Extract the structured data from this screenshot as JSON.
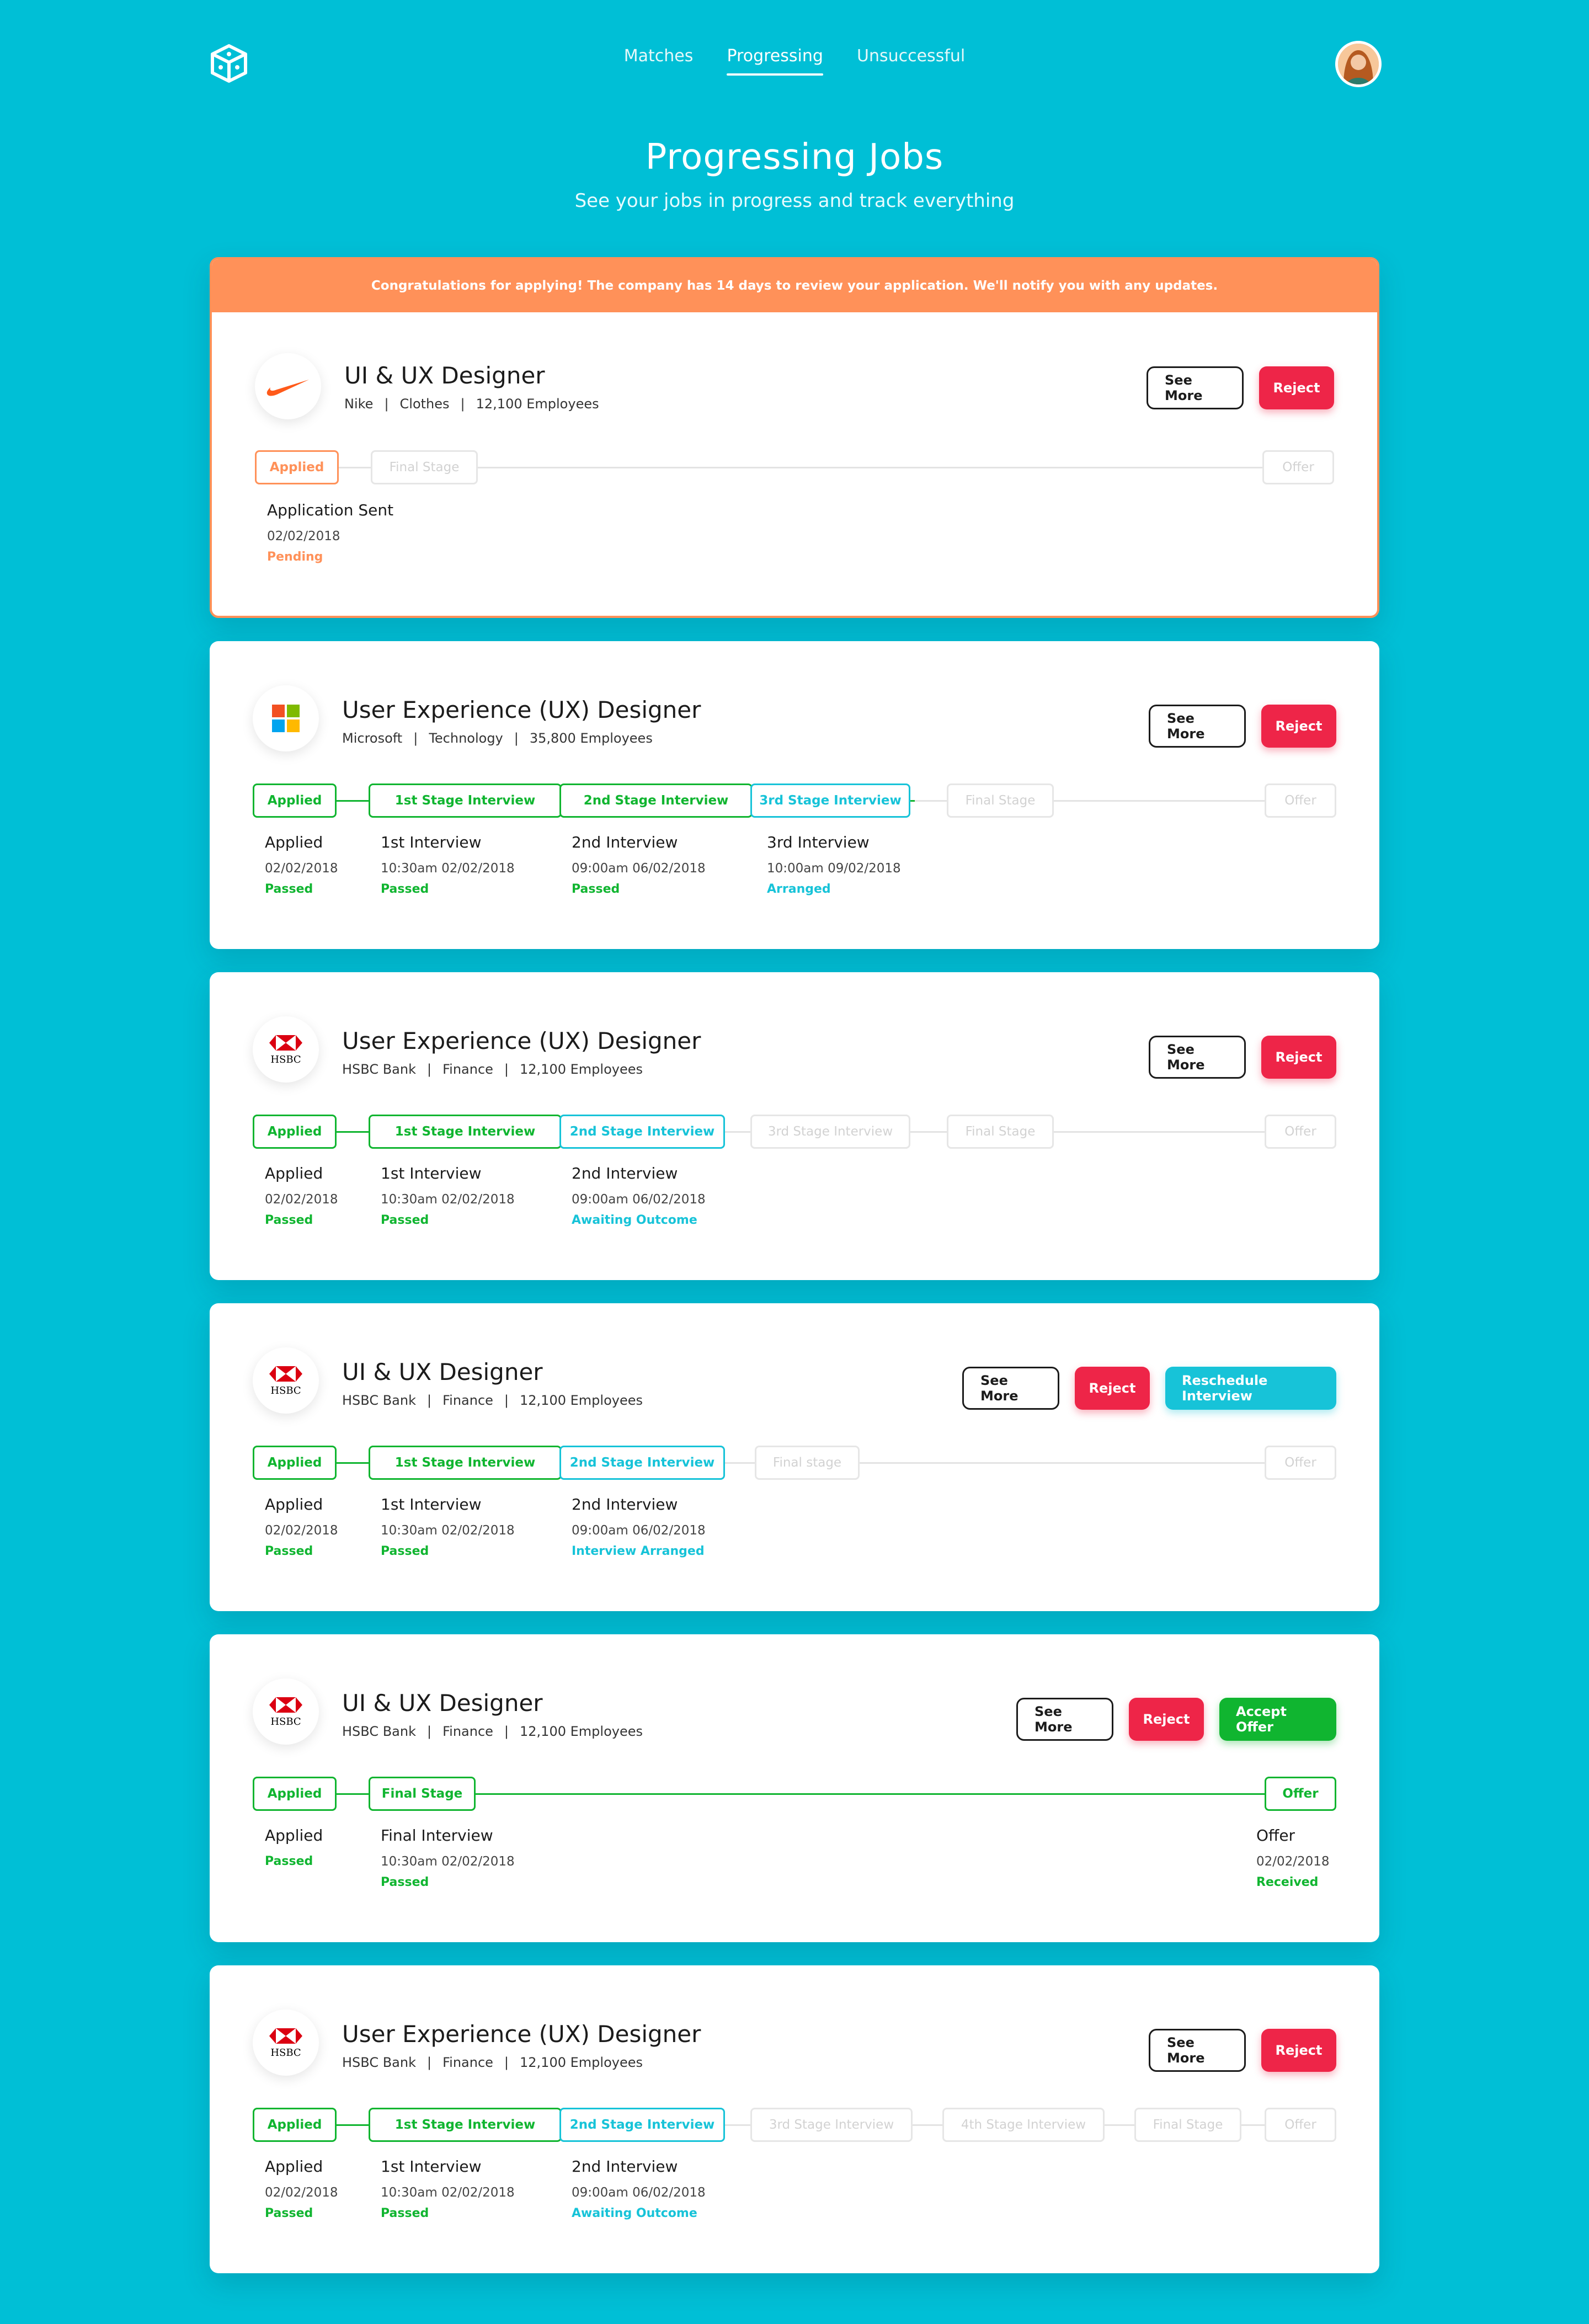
{
  "nav": {
    "tabs": [
      "Matches",
      "Progressing",
      "Unsuccessful"
    ],
    "active": "Progressing"
  },
  "header": {
    "title": "Progressing Jobs",
    "subtitle": "See your jobs in progress and track everything"
  },
  "banner": "Congratulations for applying! The company has 14 days to review your application. We'll notify you with any updates.",
  "buttons": {
    "see_more": "See More",
    "reject": "Reject",
    "reschedule": "Reschedule Interview",
    "accept": "Accept Offer"
  },
  "cards": [
    {
      "title": "UI & UX Designer",
      "company": "Nike",
      "sector": "Clothes",
      "employees": "12,100 Employees",
      "stages": [
        "Applied",
        "Final Stage",
        "Offer"
      ],
      "details": [
        {
          "title": "Application Sent",
          "date": "02/02/2018",
          "status": "Pending"
        }
      ]
    },
    {
      "title": "User Experience (UX) Designer",
      "company": "Microsoft",
      "sector": "Technology",
      "employees": "35,800 Employees",
      "stages": [
        "Applied",
        "1st Stage Interview",
        "2nd Stage Interview",
        "3rd Stage Interview",
        "Final Stage",
        "Offer"
      ],
      "details": [
        {
          "title": "Applied",
          "date": "02/02/2018",
          "status": "Passed"
        },
        {
          "title": "1st Interview",
          "date": "10:30am 02/02/2018",
          "status": "Passed"
        },
        {
          "title": "2nd Interview",
          "date": "09:00am 06/02/2018",
          "status": "Passed"
        },
        {
          "title": "3rd Interview",
          "date": "10:00am 09/02/2018",
          "status": "Arranged"
        }
      ]
    },
    {
      "title": "User Experience (UX) Designer",
      "company": "HSBC Bank",
      "sector": "Finance",
      "employees": "12,100 Employees",
      "stages": [
        "Applied",
        "1st Stage Interview",
        "2nd Stage Interview",
        "3rd Stage Interview",
        "Final Stage",
        "Offer"
      ],
      "details": [
        {
          "title": "Applied",
          "date": "02/02/2018",
          "status": "Passed"
        },
        {
          "title": "1st Interview",
          "date": "10:30am 02/02/2018",
          "status": "Passed"
        },
        {
          "title": "2nd Interview",
          "date": "09:00am 06/02/2018",
          "status": "Awaiting Outcome"
        }
      ]
    },
    {
      "title": "UI & UX Designer",
      "company": "HSBC Bank",
      "sector": "Finance",
      "employees": "12,100 Employees",
      "stages": [
        "Applied",
        "1st Stage Interview",
        "2nd Stage Interview",
        "Final stage",
        "Offer"
      ],
      "details": [
        {
          "title": "Applied",
          "date": "02/02/2018",
          "status": "Passed"
        },
        {
          "title": "1st Interview",
          "date": "10:30am 02/02/2018",
          "status": "Passed"
        },
        {
          "title": "2nd Interview",
          "date": "09:00am 06/02/2018",
          "status": "Interview Arranged"
        }
      ]
    },
    {
      "title": "UI & UX Designer",
      "company": "HSBC Bank",
      "sector": "Finance",
      "employees": "12,100 Employees",
      "stages": [
        "Applied",
        "Final Stage",
        "Offer"
      ],
      "details": [
        {
          "title": "Applied",
          "date": "",
          "status": "Passed"
        },
        {
          "title": "Final Interview",
          "date": "10:30am 02/02/2018",
          "status": "Passed"
        },
        {
          "title": "Offer",
          "date": "02/02/2018",
          "status": "Received"
        }
      ]
    },
    {
      "title": "User Experience (UX) Designer",
      "company": "HSBC Bank",
      "sector": "Finance",
      "employees": "12,100 Employees",
      "stages": [
        "Applied",
        "1st Stage Interview",
        "2nd Stage Interview",
        "3rd Stage Interview",
        "4th Stage Interview",
        "Final Stage",
        "Offer"
      ],
      "details": [
        {
          "title": "Applied",
          "date": "02/02/2018",
          "status": "Passed"
        },
        {
          "title": "1st Interview",
          "date": "10:30am 02/02/2018",
          "status": "Passed"
        },
        {
          "title": "2nd Interview",
          "date": "09:00am 06/02/2018",
          "status": "Awaiting Outcome"
        }
      ]
    }
  ],
  "logo_icons": {
    "nike": "nike-swoosh-icon",
    "microsoft": "microsoft-windows-icon",
    "hsbc": "hsbc-hexagon-icon",
    "app": "cube-logo-icon"
  },
  "colors": {
    "background": "#00bfd6",
    "accent_orange": "#ff9159",
    "passed_green": "#10b530",
    "current_teal": "#17c3d8",
    "reject_red": "#ee2548"
  }
}
